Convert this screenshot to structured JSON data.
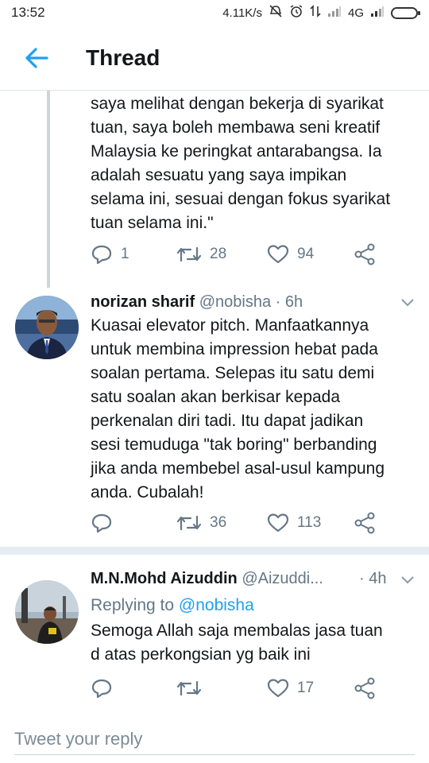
{
  "status_bar": {
    "time": "13:52",
    "speed": "4.11K/s",
    "network": "4G"
  },
  "header": {
    "title": "Thread"
  },
  "tweets": [
    {
      "text_lines": [
        "saya melihat dengan bekerja di syarikat",
        "tuan, saya boleh membawa seni kreatif",
        "Malaysia ke peringkat antarabangsa. Ia",
        "adalah sesuatu yang saya impikan",
        "selama ini, sesuai dengan fokus syarikat",
        "tuan selama ini.\""
      ],
      "replies": "1",
      "retweets": "28",
      "likes": "94"
    },
    {
      "name": "norizan sharif",
      "handle": "@nobisha",
      "time": "· 6h",
      "text_lines": [
        "Kuasai elevator pitch. Manfaatkannya",
        "untuk membina impression hebat pada",
        "soalan pertama. Selepas itu satu demi",
        "satu soalan akan berkisar kepada",
        "perkenalan diri tadi. Itu dapat jadikan",
        "sesi temuduga \"tak boring\" berbanding",
        "jika anda membebel asal-usul kampung",
        "anda. Cubalah!"
      ],
      "replies": "",
      "retweets": "36",
      "likes": "113"
    },
    {
      "name": "M.N.Mohd Aizuddin",
      "handle": "@Aizuddi...",
      "time": "· 4h",
      "replying_prefix": "Replying to",
      "replying_to": "@nobisha",
      "text_lines": [
        "Semoga Allah saja membalas jasa tuan",
        "d atas perkongsian yg baik ini"
      ],
      "replies": "",
      "retweets": "",
      "likes": "17"
    }
  ],
  "reply_box": {
    "placeholder": "Tweet your reply"
  },
  "colors": {
    "accent": "#1da1f2",
    "muted": "#657786",
    "divider": "#e6ecf0"
  }
}
